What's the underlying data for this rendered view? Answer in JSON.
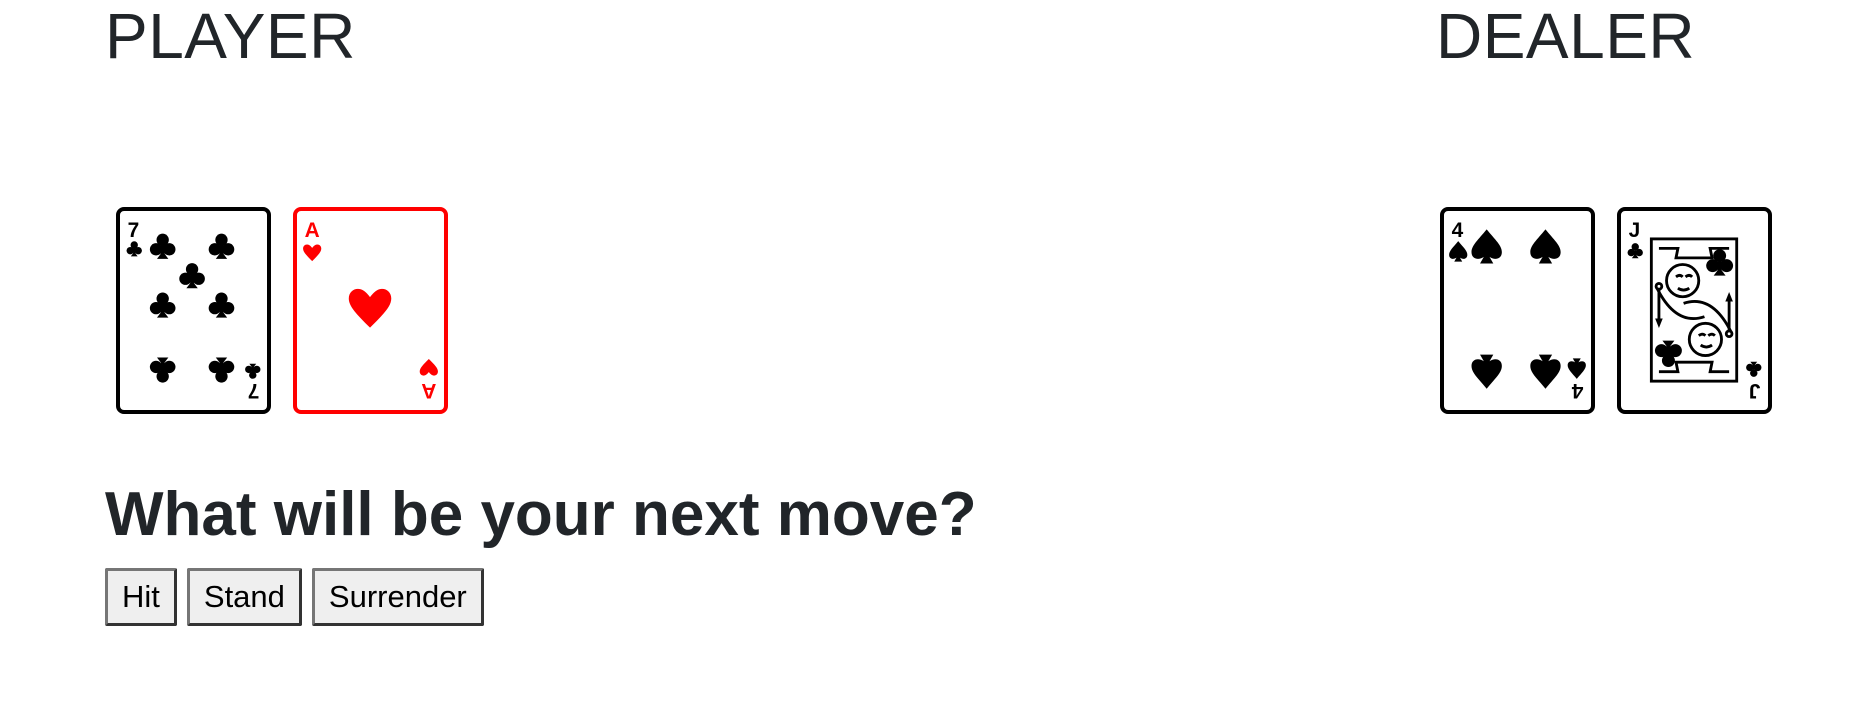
{
  "player": {
    "heading": "PLAYER",
    "cards": [
      {
        "rank": "7",
        "suit": "clubs",
        "color": "#000000"
      },
      {
        "rank": "A",
        "suit": "hearts",
        "color": "#ff0000"
      }
    ]
  },
  "dealer": {
    "heading": "DEALER",
    "cards": [
      {
        "rank": "4",
        "suit": "spades",
        "color": "#000000"
      },
      {
        "rank": "J",
        "suit": "clubs",
        "color": "#000000"
      }
    ]
  },
  "prompt": "What will be your next move?",
  "actions": {
    "hit_label": "Hit",
    "stand_label": "Stand",
    "surrender_label": "Surrender"
  }
}
